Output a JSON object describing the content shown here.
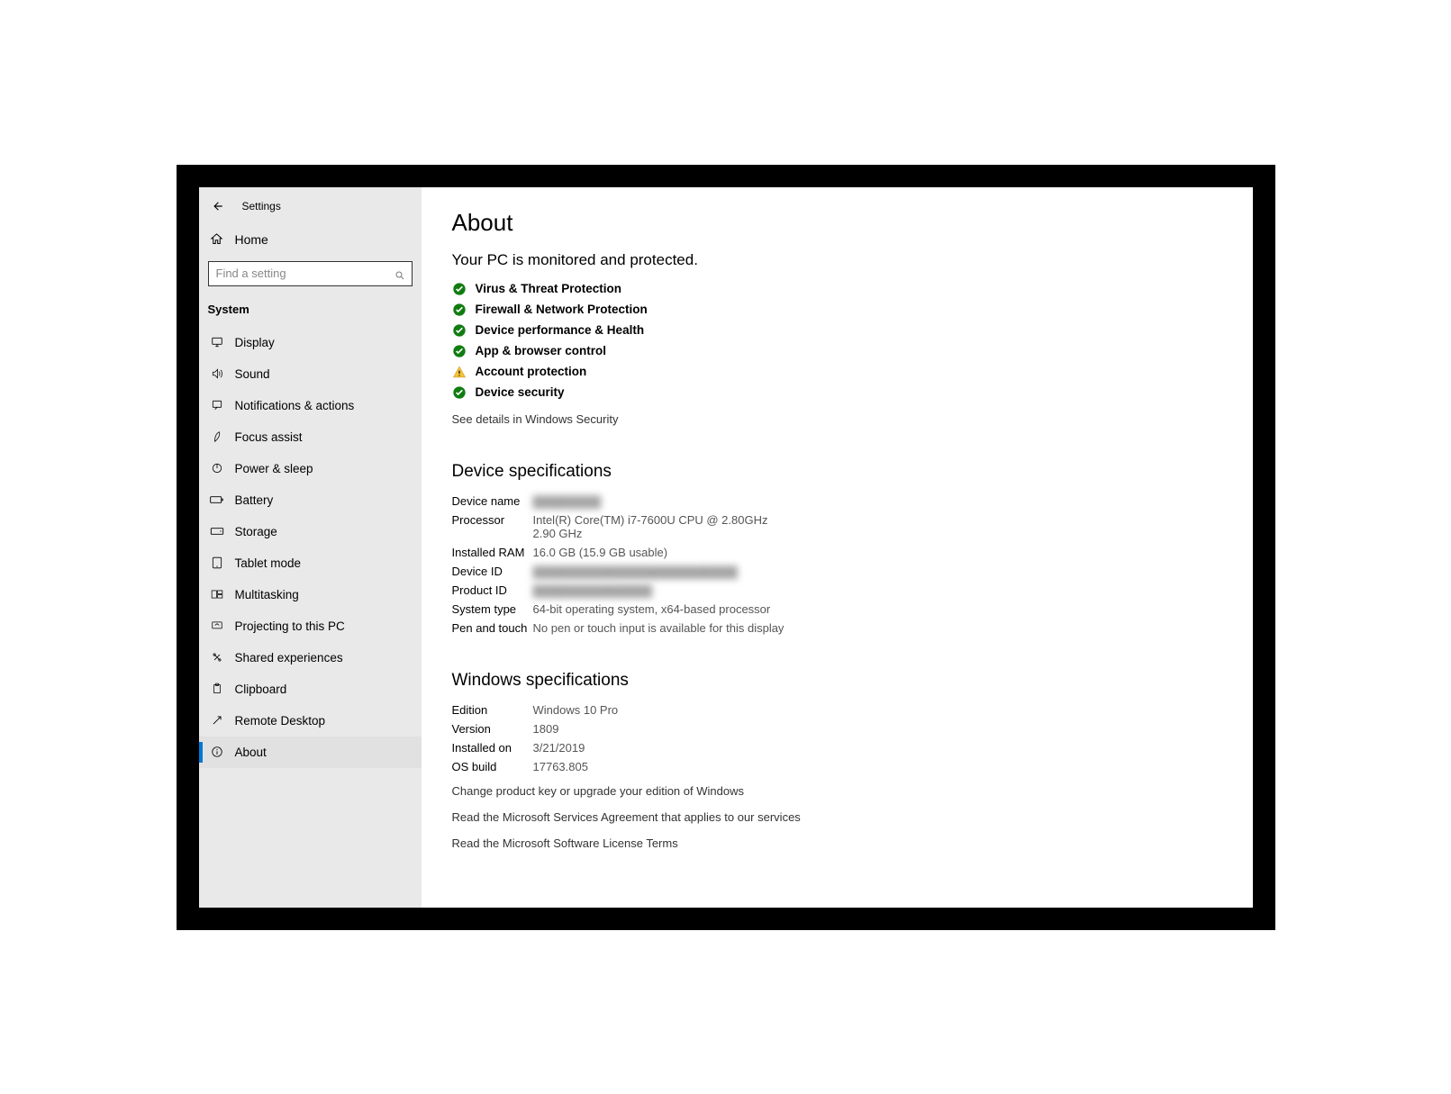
{
  "titlebar": {
    "title": "Settings"
  },
  "home": {
    "label": "Home"
  },
  "search": {
    "placeholder": "Find a setting"
  },
  "category": {
    "label": "System"
  },
  "nav": [
    {
      "id": "display",
      "label": "Display"
    },
    {
      "id": "sound",
      "label": "Sound"
    },
    {
      "id": "notifications",
      "label": "Notifications & actions"
    },
    {
      "id": "focus",
      "label": "Focus assist"
    },
    {
      "id": "power",
      "label": "Power & sleep"
    },
    {
      "id": "battery",
      "label": "Battery"
    },
    {
      "id": "storage",
      "label": "Storage"
    },
    {
      "id": "tablet",
      "label": "Tablet mode"
    },
    {
      "id": "multitasking",
      "label": "Multitasking"
    },
    {
      "id": "projecting",
      "label": "Projecting to this PC"
    },
    {
      "id": "shared",
      "label": "Shared experiences"
    },
    {
      "id": "clipboard",
      "label": "Clipboard"
    },
    {
      "id": "remote",
      "label": "Remote Desktop"
    },
    {
      "id": "about",
      "label": "About"
    }
  ],
  "page": {
    "title": "About",
    "protection_heading": "Your PC is monitored and protected.",
    "protection_items": [
      {
        "label": "Virus & Threat Protection",
        "status": "ok"
      },
      {
        "label": "Firewall & Network Protection",
        "status": "ok"
      },
      {
        "label": "Device performance & Health",
        "status": "ok"
      },
      {
        "label": "App & browser control",
        "status": "ok"
      },
      {
        "label": "Account protection",
        "status": "warn"
      },
      {
        "label": "Device security",
        "status": "ok"
      }
    ],
    "see_details": "See details in Windows Security",
    "device_specs_heading": "Device specifications",
    "device_specs": {
      "device_name_label": "Device name",
      "device_name_value": "▓▓▓▓▓▓▓▓",
      "processor_label": "Processor",
      "processor_value": "Intel(R) Core(TM) i7-7600U CPU @ 2.80GHz   2.90 GHz",
      "ram_label": "Installed RAM",
      "ram_value": "16.0 GB (15.9 GB usable)",
      "device_id_label": "Device ID",
      "device_id_value": "▓▓▓▓▓▓▓▓▓▓▓▓▓▓▓▓▓▓▓▓▓▓▓▓",
      "product_id_label": "Product ID",
      "product_id_value": "▓▓▓▓▓▓▓▓▓▓▓▓▓▓",
      "system_type_label": "System type",
      "system_type_value": "64-bit operating system, x64-based processor",
      "pen_touch_label": "Pen and touch",
      "pen_touch_value": "No pen or touch input is available for this display"
    },
    "windows_specs_heading": "Windows specifications",
    "windows_specs": {
      "edition_label": "Edition",
      "edition_value": "Windows 10 Pro",
      "version_label": "Version",
      "version_value": "1809",
      "installed_label": "Installed on",
      "installed_value": "3/21/2019",
      "build_label": "OS build",
      "build_value": "17763.805"
    },
    "links": {
      "change_key": "Change product key or upgrade your edition of Windows",
      "msa": "Read the Microsoft Services Agreement that applies to our services",
      "license": "Read the Microsoft Software License Terms"
    }
  }
}
